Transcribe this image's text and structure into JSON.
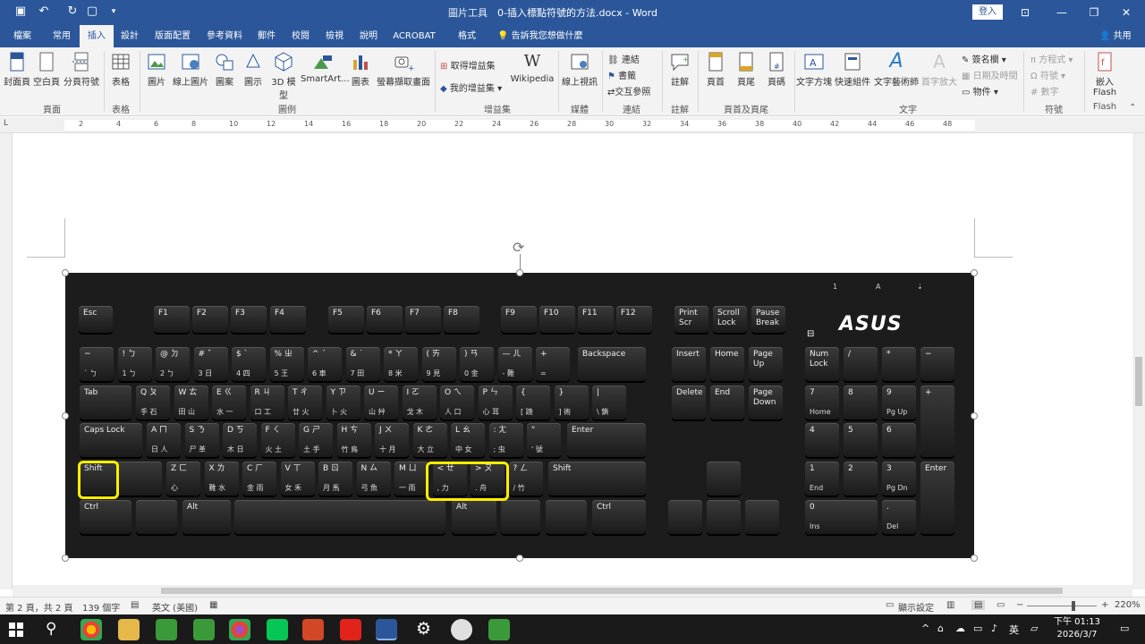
{
  "title_bar": {
    "context_label": "圖片工具",
    "document_title": "0-插入標點符號的方法.docx - Word",
    "sign_in": "登入"
  },
  "tabs": [
    "檔案",
    "常用",
    "插入",
    "設計",
    "版面配置",
    "參考資料",
    "郵件",
    "校閱",
    "檢視",
    "說明",
    "ACROBAT",
    "格式"
  ],
  "active_tab": "插入",
  "tell_me": "告訴我您想做什麼",
  "share": "共用",
  "ribbon": {
    "pages": {
      "cover": "封面頁",
      "blank": "空白頁",
      "break": "分頁符號",
      "label": "頁面"
    },
    "tables": {
      "table": "表格",
      "label": "表格"
    },
    "illustrations": {
      "picture": "圖片",
      "online_picture": "線上圖片",
      "shapes": "圖案",
      "icons": "圖示",
      "model3d": "3D 模型",
      "smartart": "SmartArt...",
      "chart": "圖表",
      "screenshot": "螢幕擷取畫面",
      "label": "圖例"
    },
    "addins": {
      "get": "取得增益集",
      "mine": "我的增益集",
      "wikipedia": "Wikipedia",
      "label": "增益集"
    },
    "media": {
      "online_video": "線上視訊",
      "label": "媒體"
    },
    "links": {
      "link": "連結",
      "bookmark": "書籤",
      "crossref": "交互參照",
      "label": "連結"
    },
    "comments": {
      "comment": "註解",
      "label": "註解"
    },
    "header_footer": {
      "header": "頁首",
      "footer": "頁尾",
      "page_number": "頁碼",
      "label": "頁首及頁尾"
    },
    "text": {
      "textbox": "文字方塊",
      "quickparts": "快速組件",
      "wordart": "文字藝術師",
      "dropcap": "首字放大",
      "signature": "簽名欄",
      "datetime": "日期及時間",
      "object": "物件",
      "label": "文字"
    },
    "symbols": {
      "equation": "方程式",
      "symbol": "符號",
      "number": "數字",
      "label": "符號"
    },
    "flash": {
      "embed": "嵌入 Flash",
      "label": "Flash"
    }
  },
  "ruler_numbers": [
    "2",
    "4",
    "6",
    "8",
    "10",
    "12",
    "14",
    "16",
    "18",
    "20",
    "22",
    "24",
    "26",
    "28",
    "30",
    "32",
    "34",
    "36",
    "38",
    "40",
    "42",
    "44",
    "46",
    "48"
  ],
  "keyboard": {
    "brand": "ASUS",
    "indicators": [
      "1",
      "A",
      "⇣"
    ],
    "fn_row": [
      "Esc",
      "F1",
      "F2",
      "F3",
      "F4",
      "F5",
      "F6",
      "F7",
      "F8",
      "F9",
      "F10",
      "F11",
      "F12",
      "Print Scr",
      "Scroll Lock",
      "Pause Break"
    ],
    "row1": [
      {
        "top": "~",
        "bot": "` ㄅ"
      },
      {
        "top": "! ㄅ",
        "bot": "1 ㄅ"
      },
      {
        "top": "@ ㄉ",
        "bot": "2 ㄅ"
      },
      {
        "top": "# ˇ",
        "bot": "3 日"
      },
      {
        "top": "$ ˋ",
        "bot": "4 四"
      },
      {
        "top": "% ㄓ",
        "bot": "5 王"
      },
      {
        "top": "^ ˊ",
        "bot": "6 車"
      },
      {
        "top": "& ˙",
        "bot": "7 田"
      },
      {
        "top": "* ㄚ",
        "bot": "8 米"
      },
      {
        "top": "( ㄞ",
        "bot": "9 見"
      },
      {
        "top": ") ㄢ",
        "bot": "0 金"
      },
      {
        "top": "— ㄦ",
        "bot": "- 難"
      },
      {
        "top": "+",
        "bot": "="
      }
    ],
    "row2": [
      {
        "top": "Q ㄆ",
        "bot": "手 石"
      },
      {
        "top": "W ㄊ",
        "bot": "田 山"
      },
      {
        "top": "E ㄍ",
        "bot": "水 一"
      },
      {
        "top": "R ㄐ",
        "bot": "口 工"
      },
      {
        "top": "T ㄔ",
        "bot": "廿 火"
      },
      {
        "top": "Y ㄗ",
        "bot": "卜 火"
      },
      {
        "top": "U ㄧ",
        "bot": "山 艸"
      },
      {
        "top": "I ㄛ",
        "bot": "戈 木"
      },
      {
        "top": "O ㄟ",
        "bot": "人 口"
      },
      {
        "top": "P ㄣ",
        "bot": "心 耳"
      },
      {
        "top": "{",
        "bot": "[ 蹺"
      },
      {
        "top": "}",
        "bot": "] 術"
      },
      {
        "top": "|",
        "bot": "\\ 鎖"
      }
    ],
    "row3": [
      {
        "top": "A ㄇ",
        "bot": "日 人"
      },
      {
        "top": "S ㄋ",
        "bot": "尸 革"
      },
      {
        "top": "D ㄎ",
        "bot": "木 日"
      },
      {
        "top": "F ㄑ",
        "bot": "火 土"
      },
      {
        "top": "G ㄕ",
        "bot": "土 手"
      },
      {
        "top": "H ㄘ",
        "bot": "竹 鳥"
      },
      {
        "top": "J ㄨ",
        "bot": "十 月"
      },
      {
        "top": "K ㄜ",
        "bot": "大 立"
      },
      {
        "top": "L ㄠ",
        "bot": "中 女"
      },
      {
        "top": ": ㄤ",
        "bot": "; 虫"
      },
      {
        "top": "\"",
        "bot": "' 號"
      }
    ],
    "row4": [
      {
        "top": "Z ㄈ",
        "bot": "心"
      },
      {
        "top": "X ㄌ",
        "bot": "難 水"
      },
      {
        "top": "C ㄏ",
        "bot": "金 雨"
      },
      {
        "top": "V ㄒ",
        "bot": "女 禾"
      },
      {
        "top": "B ㄖ",
        "bot": "月 馬"
      },
      {
        "top": "N ㄙ",
        "bot": "弓 魚"
      },
      {
        "top": "M ㄩ",
        "bot": "一 雨"
      },
      {
        "top": "< ㄝ",
        "bot": ", 力"
      },
      {
        "top": "> ㄡ",
        "bot": ". 舟"
      },
      {
        "top": "? ㄥ",
        "bot": "/ 竹"
      }
    ],
    "named": {
      "backspace": "Backspace",
      "tab": "Tab",
      "caps": "Caps Lock",
      "enter": "Enter",
      "shift": "Shift",
      "ctrl": "Ctrl",
      "alt": "Alt",
      "insert": "Insert",
      "home": "Home",
      "pageup": "Page Up",
      "delete": "Delete",
      "end": "End",
      "pagedown": "Page Down",
      "numlock": "Num Lock",
      "slash": "/",
      "star": "*",
      "minus": "−",
      "plus": "+",
      "n7": "7",
      "n8": "8",
      "n9": "9",
      "n4": "4",
      "n5": "5",
      "n6": "6",
      "n1": "1",
      "n2": "2",
      "n3": "3",
      "n0": "0",
      "dot": ".",
      "n7s": "Home",
      "n9s": "Pg Up",
      "n1s": "End",
      "n3s": "Pg Dn",
      "n0s": "Ins",
      "dots": "Del",
      "num_enter": "Enter"
    }
  },
  "status": {
    "page": "第 2 頁，共 2 頁",
    "words": "139 個字",
    "language": "英文 (美國)",
    "display": "顯示設定",
    "zoom": "220%"
  },
  "taskbar": {
    "ime": "英",
    "time": "下午 01:13",
    "date": "2026/3/7"
  }
}
